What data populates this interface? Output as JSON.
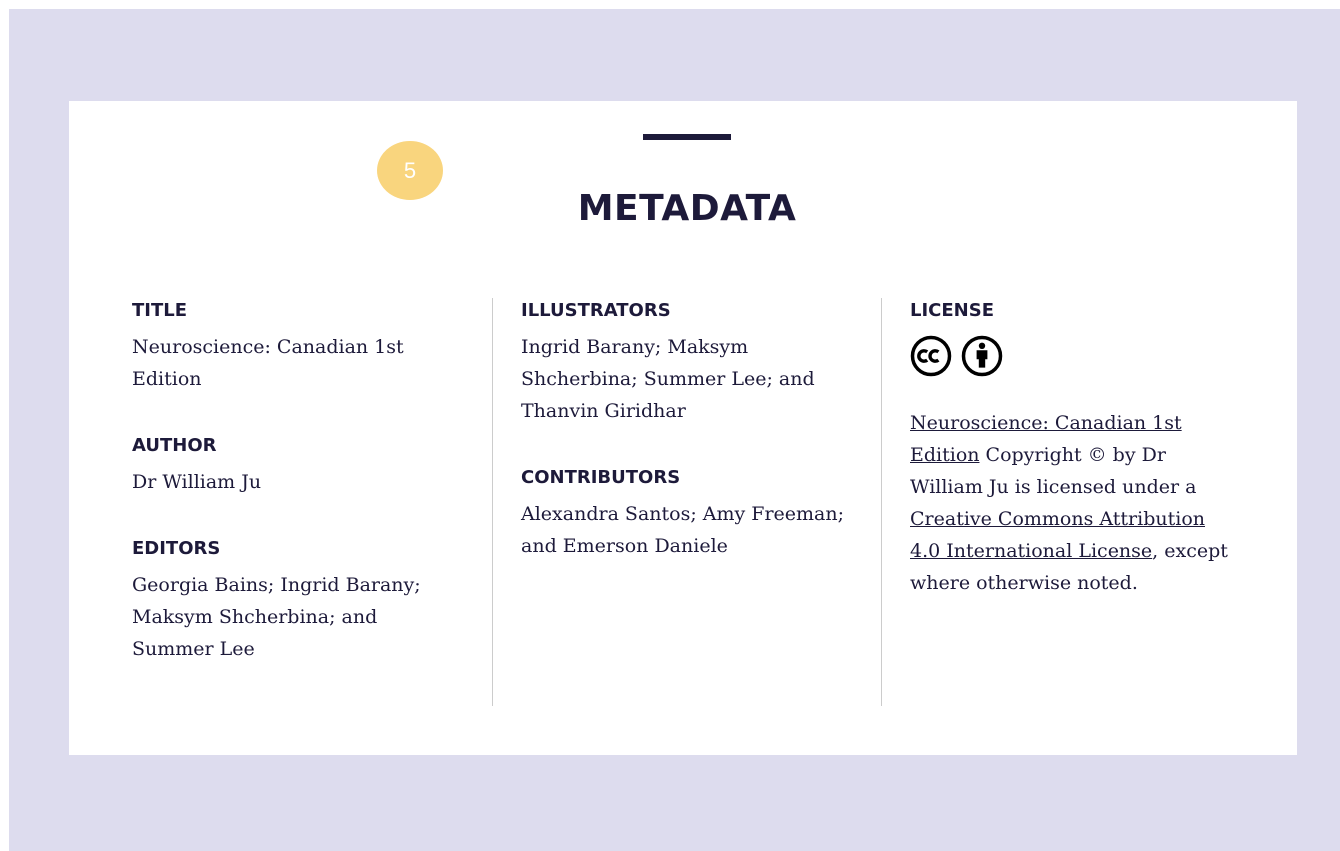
{
  "badge": "5",
  "page_title": "METADATA",
  "title": {
    "heading": "TITLE",
    "value": "Neuroscience: Canadian 1st Edition"
  },
  "author": {
    "heading": "AUTHOR",
    "value": "Dr William Ju"
  },
  "editors": {
    "heading": "EDITORS",
    "value": "Georgia Bains; Ingrid Barany; Maksym Shcherbina; and Summer Lee"
  },
  "illustrators": {
    "heading": "ILLUSTRATORS",
    "value": "Ingrid Barany; Maksym Shcherbina; Summer Lee; and Thanvin Giridhar"
  },
  "contributors": {
    "heading": "CONTRIBUTORS",
    "value": "Alexandra Santos; Amy Freeman; and Emerson Daniele"
  },
  "license": {
    "heading": "LICENSE",
    "icons": [
      "cc-icon",
      "attribution-icon"
    ],
    "book_link": "Neuroscience: Canadian 1st Edition",
    "copyright_text": " Copyright © by Dr William Ju is licensed under a ",
    "license_link": "Creative Commons Attribution 4.0 International License",
    "suffix_text": ", except where otherwise noted."
  },
  "colors": {
    "frame_background": "#dddcee",
    "text": "#1d1a3a",
    "badge": "#f9d57e"
  }
}
